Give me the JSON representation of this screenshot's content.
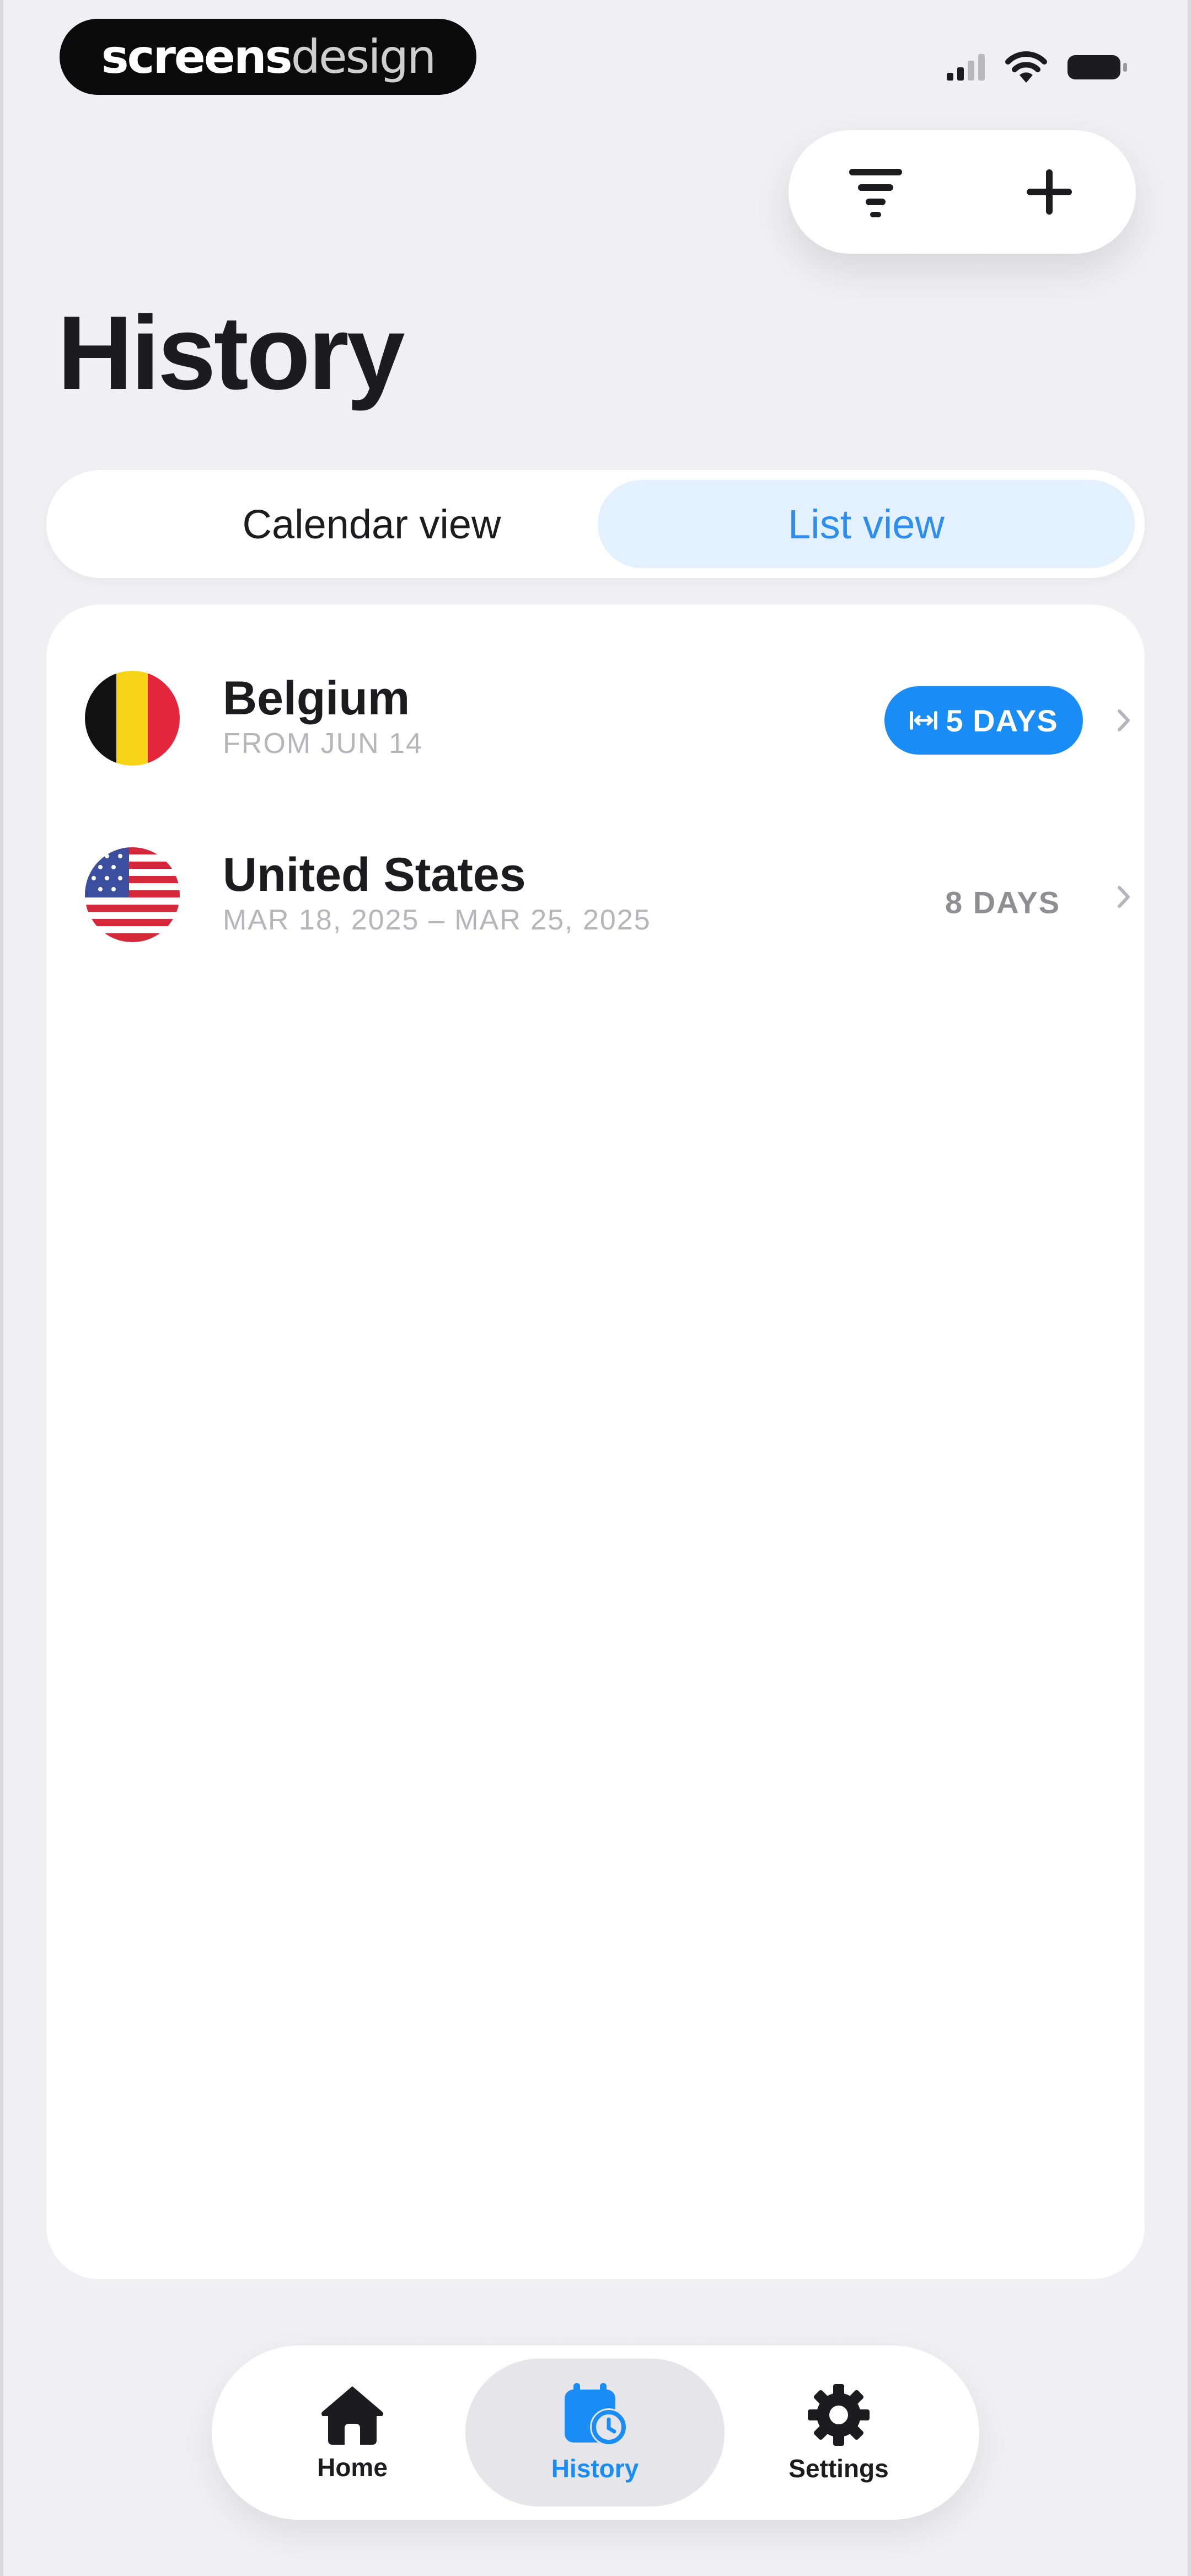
{
  "status_bar": {
    "brand_bold": "screens",
    "brand_light": "design"
  },
  "toolbar": {
    "filter_icon": "filter-icon",
    "add_icon": "plus-icon"
  },
  "page": {
    "title": "History"
  },
  "view_switch": {
    "options": [
      {
        "label": "Calendar view",
        "selected": false
      },
      {
        "label": "List view",
        "selected": true
      }
    ]
  },
  "trips": [
    {
      "country": "Belgium",
      "dates": "FROM JUN 14",
      "duration": "5 DAYS",
      "active": true,
      "flag": "belgium-flag"
    },
    {
      "country": "United States",
      "dates": "MAR 18, 2025 – MAR 25, 2025",
      "duration": "8 DAYS",
      "active": false,
      "flag": "usa-flag"
    }
  ],
  "tabbar": {
    "items": [
      {
        "label": "Home",
        "icon": "home-icon",
        "selected": false
      },
      {
        "label": "History",
        "icon": "calendar-history-icon",
        "selected": true
      },
      {
        "label": "Settings",
        "icon": "gear-icon",
        "selected": false
      }
    ]
  },
  "colors": {
    "accent": "#1a8cf5",
    "accent_light": "#e3f0fd",
    "background": "#efeff4"
  }
}
